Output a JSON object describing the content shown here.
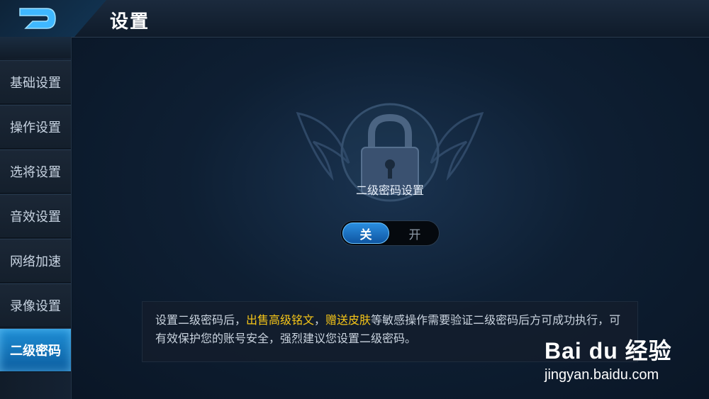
{
  "header": {
    "title": "设置"
  },
  "sidebar": {
    "items": [
      {
        "label": "基础设置",
        "active": false
      },
      {
        "label": "操作设置",
        "active": false
      },
      {
        "label": "选将设置",
        "active": false
      },
      {
        "label": "音效设置",
        "active": false
      },
      {
        "label": "网络加速",
        "active": false
      },
      {
        "label": "录像设置",
        "active": false
      },
      {
        "label": "二级密码",
        "active": true
      }
    ]
  },
  "main": {
    "setting_label": "二级密码设置",
    "toggle": {
      "off_label": "关",
      "on_label": "开",
      "selected": "关"
    },
    "info": {
      "part1": "设置二级密码后，",
      "highlight1": "出售高级铭文",
      "sep": "，",
      "highlight2": "赠送皮肤",
      "part2": "等敏感操作需要验证二级密码后方可成功执行，可有效保护您的账号安全，强烈建议您设置二级密码。"
    }
  },
  "watermark": {
    "logo": "Bai du 经验",
    "url": "jingyan.baidu.com"
  },
  "colors": {
    "accent": "#1f8fd6",
    "highlight": "#f5c518",
    "background": "#0a1624"
  }
}
